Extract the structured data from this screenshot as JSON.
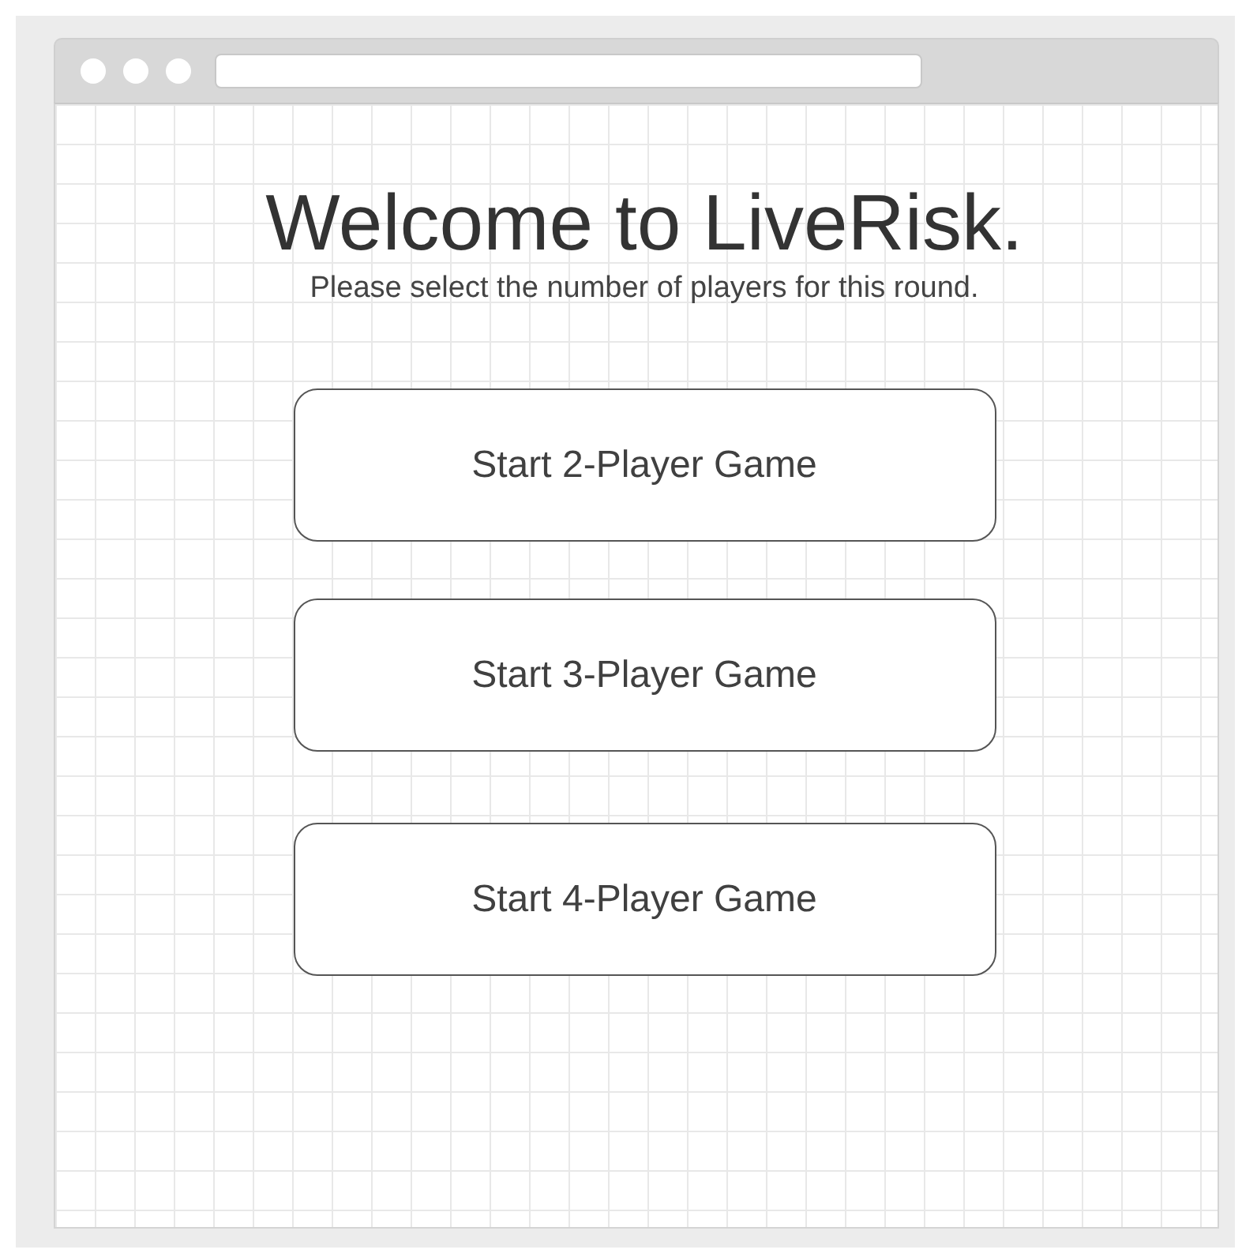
{
  "title": "Welcome to LiveRisk.",
  "subtitle": "Please select the number of players for this round.",
  "buttons": [
    {
      "label": "Start 2-Player Game"
    },
    {
      "label": "Start 3-Player Game"
    },
    {
      "label": "Start 4-Player Game"
    }
  ]
}
